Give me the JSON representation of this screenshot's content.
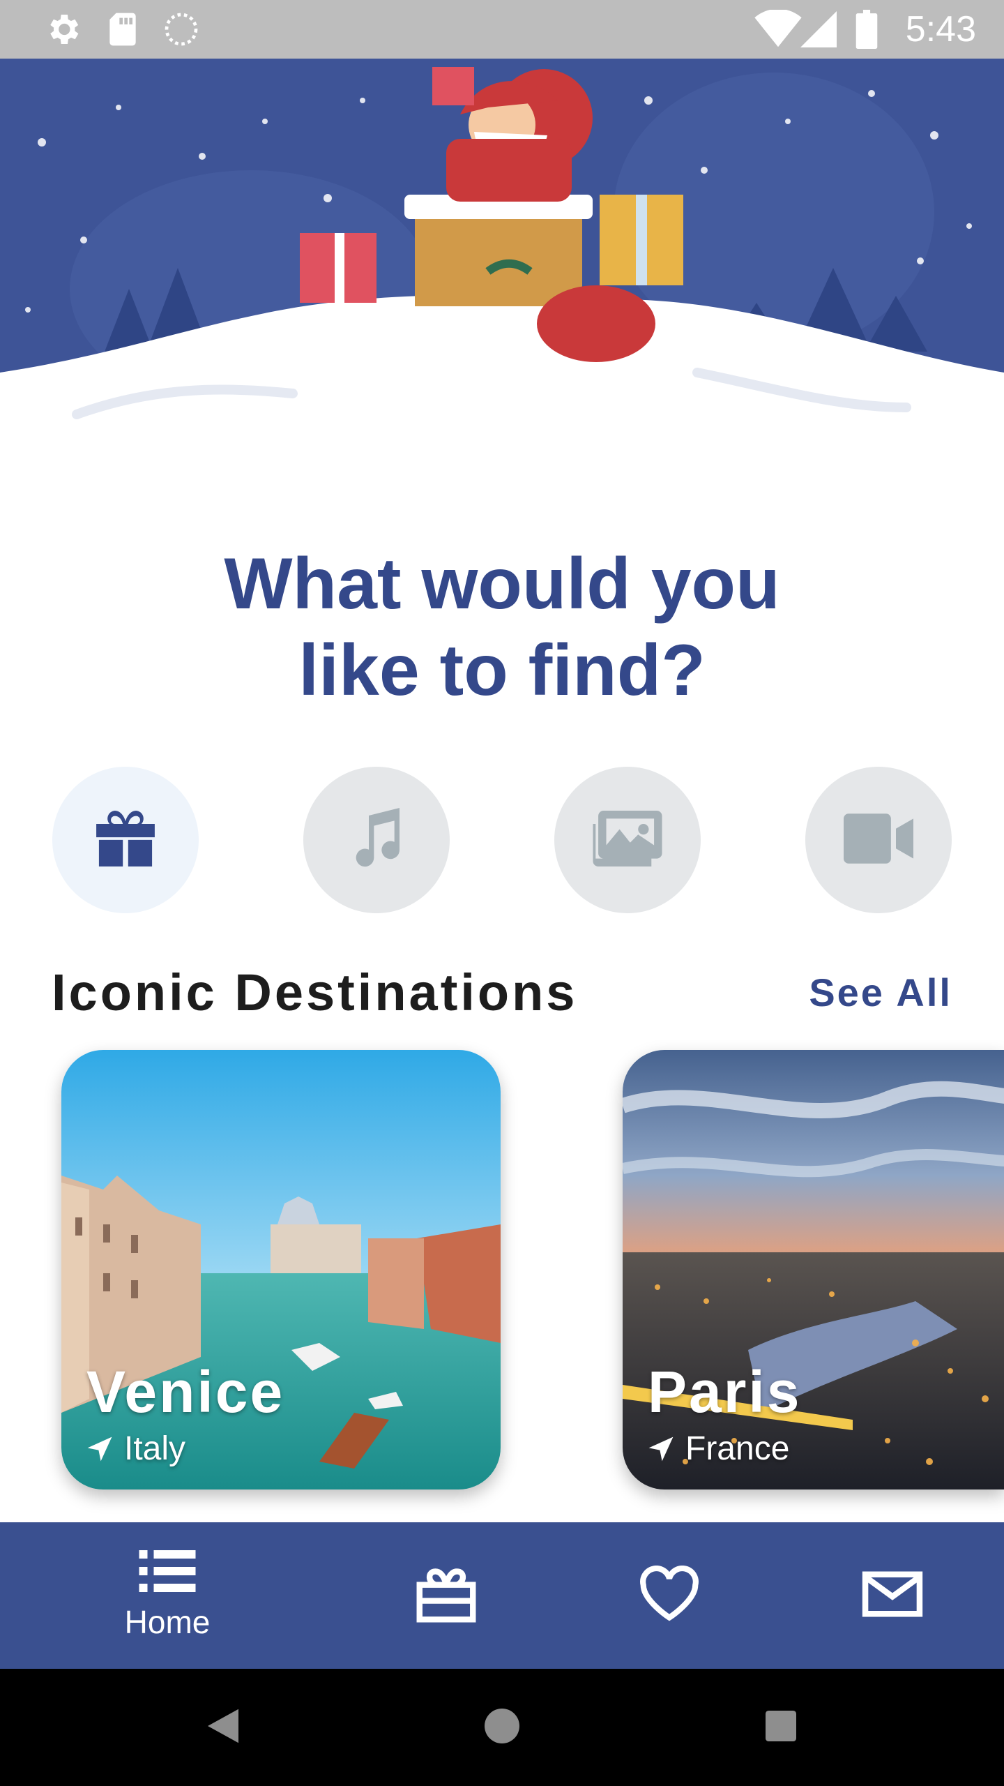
{
  "status_bar": {
    "time": "5:43",
    "left_icons": [
      "gear-icon",
      "sd-card-icon",
      "sync-icon"
    ],
    "right_icons": [
      "wifi-icon",
      "signal-icon",
      "battery-icon"
    ]
  },
  "hero": {
    "illustration": "santa-chimney-illustration"
  },
  "heading": {
    "line1": "What would you",
    "line2": "like to find?"
  },
  "categories": [
    {
      "icon": "gift-icon",
      "selected": true
    },
    {
      "icon": "music-icon",
      "selected": false
    },
    {
      "icon": "gallery-icon",
      "selected": false
    },
    {
      "icon": "video-icon",
      "selected": false
    }
  ],
  "section": {
    "title": "Iconic Destinations",
    "see_all": "See All"
  },
  "destinations": [
    {
      "city": "Venice",
      "country": "Italy"
    },
    {
      "city": "Paris",
      "country": "France"
    }
  ],
  "bottom_nav": {
    "items": [
      {
        "icon": "list-icon",
        "label": "Home",
        "active": true
      },
      {
        "icon": "gift-box-icon",
        "label": ""
      },
      {
        "icon": "heart-icon",
        "label": ""
      },
      {
        "icon": "mail-icon",
        "label": ""
      }
    ]
  },
  "colors": {
    "primary": "#34488a",
    "nav_bg": "#3a5090",
    "status_bar": "#bdbdbd",
    "category_inactive": "#e5e7e9",
    "category_active": "#eef4fb"
  }
}
